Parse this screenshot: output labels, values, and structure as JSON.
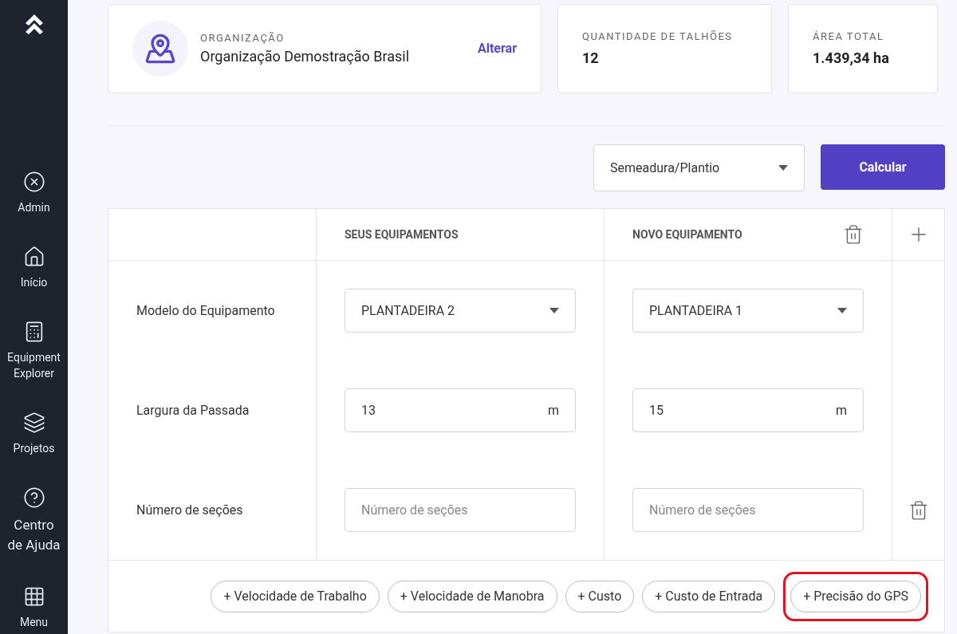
{
  "sidebar": {
    "items": [
      {
        "kind": "admin",
        "label": "Admin"
      },
      {
        "kind": "home",
        "label": "Início"
      },
      {
        "kind": "calculator",
        "label": "Equipment Explorer"
      },
      {
        "kind": "layers",
        "label": "Projetos"
      },
      {
        "kind": "help",
        "label": "Centro de Ajuda"
      },
      {
        "kind": "grid",
        "label": "Menu"
      }
    ]
  },
  "organization": {
    "label": "ORGANIZAÇÃO",
    "name": "Organização Demostração Brasil",
    "action": "Alterar"
  },
  "stats": [
    {
      "label": "QUANTIDADE DE TALHÕES",
      "value": "12"
    },
    {
      "label": "ÁREA TOTAL",
      "value": "1.439,34 ha"
    }
  ],
  "operation_select": {
    "value": "Semeadura/Plantio"
  },
  "calculate_button": "Calcular",
  "table": {
    "columns": [
      "SEUS EQUIPAMENTOS",
      "NOVO EQUIPAMENTO"
    ],
    "rows": [
      {
        "label": "Modelo do Equipamento",
        "kind": "select",
        "cells": [
          {
            "value": "PLANTADEIRA 2"
          },
          {
            "value": "PLANTADEIRA 1"
          }
        ],
        "removable": false
      },
      {
        "label": "Largura da Passada",
        "kind": "unit",
        "cells": [
          {
            "value": "13",
            "unit": "m"
          },
          {
            "value": "15",
            "unit": "m"
          }
        ],
        "removable": false
      },
      {
        "label": "Número de seções",
        "kind": "input",
        "cells": [
          {
            "placeholder": "Número de seções"
          },
          {
            "placeholder": "Número de seções"
          }
        ],
        "removable": true
      }
    ],
    "chips": [
      {
        "label": "+ Velocidade de Trabalho",
        "highlighted": false
      },
      {
        "label": "+ Velocidade de Manobra",
        "highlighted": false
      },
      {
        "label": "+ Custo",
        "highlighted": false
      },
      {
        "label": "+ Custo de Entrada",
        "highlighted": false
      },
      {
        "label": "+ Precisão do GPS",
        "highlighted": true
      }
    ]
  }
}
